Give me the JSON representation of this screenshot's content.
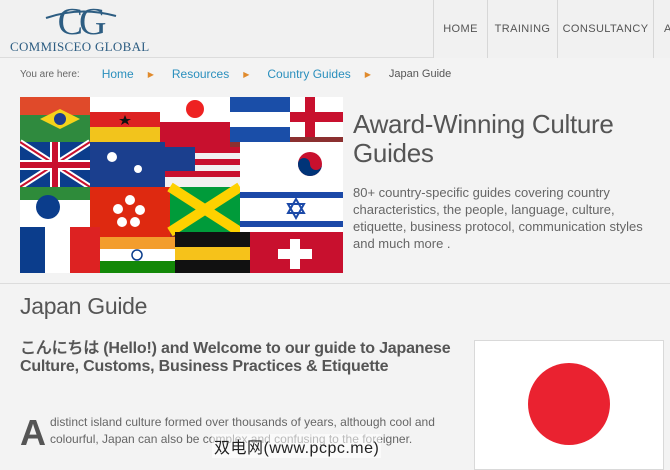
{
  "brand": {
    "logo_mark": "CG",
    "name": "Commisceo Global",
    "colors": {
      "primary": "#2d5d82",
      "link": "#2a8fbd",
      "separator": "#e08a2c",
      "flag_red": "#ea2230"
    }
  },
  "nav": {
    "items": [
      {
        "label": "HOME"
      },
      {
        "label": "TRAINING"
      },
      {
        "label": "CONSULTANCY"
      },
      {
        "label": "A"
      }
    ]
  },
  "breadcrumb": {
    "label": "You are here:",
    "links": [
      "Home",
      "Resources",
      "Country Guides"
    ],
    "separator_icon": "chevron-right-icon",
    "current": "Japan Guide"
  },
  "promo": {
    "banner_icon": "world-flags-image",
    "title": "Award-Winning Culture Guides",
    "text": "80+ country-specific guides covering country characteristics, the people, language, culture, etiquette, business protocol, communication styles and much more ."
  },
  "guide": {
    "title": "Japan Guide",
    "intro_heading": "こんにちは (Hello!) and Welcome to our guide to Japanese Culture, Customs, Business Practices & Etiquette",
    "dropcap": "A",
    "body": "distinct island culture formed over thousands of years, although cool and colourful, Japan can also be complex and confusing to the foreigner.",
    "flag_icon": "japan-flag-icon"
  },
  "watermark": "双电网(www.pcpc.me)"
}
